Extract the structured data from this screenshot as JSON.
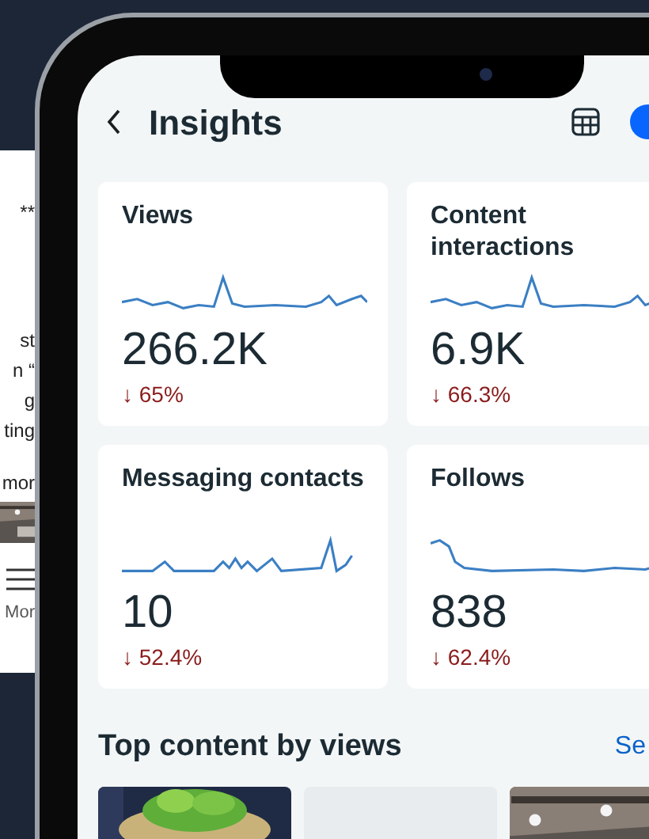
{
  "background_phone": {
    "texts": [
      "**",
      "st",
      "n “",
      "g",
      "ting",
      "mor"
    ],
    "tab_label": "Mor"
  },
  "header": {
    "title": "Insights"
  },
  "cards": [
    {
      "title": "Views",
      "value": "266.2K",
      "change": "↓ 65%"
    },
    {
      "title": "Content interactions",
      "value": "6.9K",
      "change": "↓ 66.3%"
    },
    {
      "title": "Messaging contacts",
      "value": "10",
      "change": "↓ 52.4%"
    },
    {
      "title": "Follows",
      "value": "838",
      "change": "↓ 62.4%"
    }
  ],
  "section": {
    "title": "Top content by views",
    "link": "Se"
  },
  "thumbnails": [
    {
      "kind": "picture"
    },
    {
      "kind": "blank"
    },
    {
      "kind": "picture"
    }
  ]
}
